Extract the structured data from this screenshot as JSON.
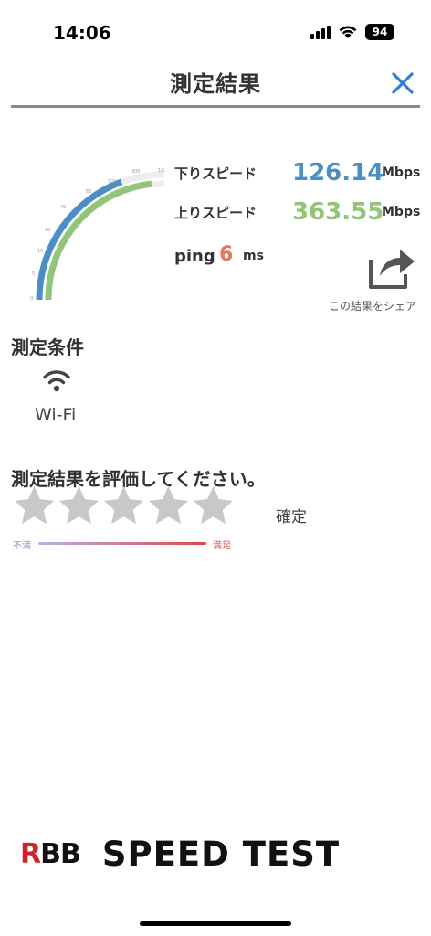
{
  "status_bar": {
    "time": "14:06",
    "battery": "94"
  },
  "header": {
    "title": "測定結果"
  },
  "gauge": {
    "ticks": [
      "0",
      "5",
      "10",
      "20",
      "40",
      "80",
      "120",
      "300",
      "1G"
    ],
    "download_color": "#4a8fc3",
    "upload_color": "#94c47a"
  },
  "results": {
    "download_label": "下りスピード",
    "download_value": "126.14",
    "download_unit": "Mbps",
    "upload_label": "上りスピード",
    "upload_value": "363.55",
    "upload_unit": "Mbps",
    "ping_label": "ping",
    "ping_value": "6",
    "ping_unit": "ms"
  },
  "share": {
    "label": "この結果をシェア"
  },
  "conditions": {
    "title": "測定条件",
    "network": "Wi-Fi"
  },
  "rating": {
    "title": "測定結果を評価してください。",
    "confirm": "確定",
    "min_label": "不満",
    "max_label": "満足"
  },
  "logo": {
    "rbb_r": "R",
    "rbb_rest": "BB",
    "speed_test": "SPEED TEST"
  },
  "colors": {
    "download": "#4a8fc3",
    "upload": "#94c47a",
    "ping": "#e07a5f",
    "accent": "#2f7dd6"
  }
}
